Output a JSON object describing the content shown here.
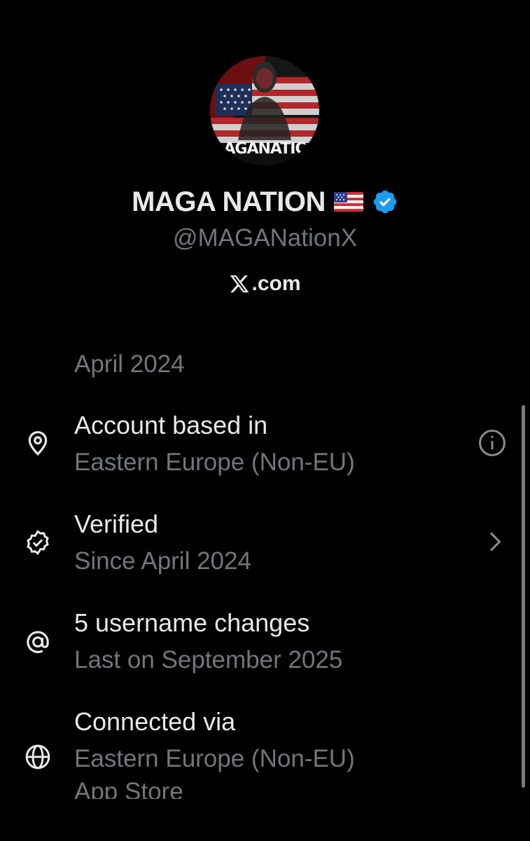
{
  "profile": {
    "avatar_caption": "AGANATIC",
    "display_name": "MAGA NATION",
    "flag_icon": "us-flag-icon",
    "badge_icon": "verified-badge-icon",
    "badge_color": "#1d9bf0",
    "handle": "@MAGANationX",
    "site_logo": "x-logo-icon",
    "site_suffix": ".com"
  },
  "about": {
    "clipped_subtitle": "April 2024",
    "items": [
      {
        "icon": "location-pin-icon",
        "title": "Account based in",
        "subtitle": "Eastern Europe (Non-EU)",
        "trailing_icon": "info-icon"
      },
      {
        "icon": "verified-check-icon",
        "title": "Verified",
        "subtitle": "Since April 2024",
        "trailing_icon": "chevron-right-icon"
      },
      {
        "icon": "at-sign-icon",
        "title": "5 username changes",
        "subtitle": "Last on September 2025"
      },
      {
        "icon": "globe-icon",
        "title": "Connected via",
        "subtitle": "Eastern Europe (Non-EU)",
        "subtitle2": "App Store"
      }
    ]
  },
  "colors": {
    "background": "#000000",
    "primary_text": "#e7e9ea",
    "secondary_text": "#71767b",
    "accent": "#1d9bf0"
  }
}
